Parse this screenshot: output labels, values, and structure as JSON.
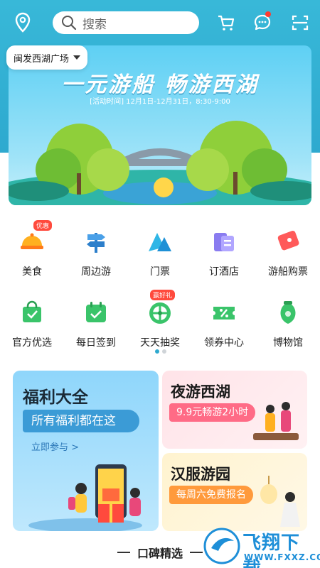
{
  "header": {
    "search_placeholder": "搜索",
    "location": "闽发西湖广场"
  },
  "banner": {
    "title": "一元游船 畅游西湖",
    "subtitle": "[活动时间] 12月1日-12月31日，8:30-9:00"
  },
  "grid_row1": [
    {
      "label": "美食",
      "tag": "优惠"
    },
    {
      "label": "周边游",
      "tag": ""
    },
    {
      "label": "门票",
      "tag": ""
    },
    {
      "label": "订酒店",
      "tag": ""
    },
    {
      "label": "游船购票",
      "tag": ""
    }
  ],
  "grid_row2": [
    {
      "label": "官方优选",
      "tag": ""
    },
    {
      "label": "每日签到",
      "tag": ""
    },
    {
      "label": "天天抽奖",
      "tag": "赢好礼"
    },
    {
      "label": "领券中心",
      "tag": ""
    },
    {
      "label": "博物馆",
      "tag": ""
    }
  ],
  "cards": {
    "welfare": {
      "title": "福利大全",
      "pill": "所有福利都在这",
      "link": "立即参与 >"
    },
    "night": {
      "title": "夜游西湖",
      "pill": "9.9元畅游2小时"
    },
    "hanfu": {
      "title": "汉服游园",
      "pill": "每周六免费报名"
    }
  },
  "section_title": "口碑精选",
  "watermark": {
    "line1": "飞翔下载",
    "line2": "WWW.FXXZ.COM"
  },
  "colors": {
    "primary": "#2ea9cf",
    "badge": "#ff3b30"
  }
}
